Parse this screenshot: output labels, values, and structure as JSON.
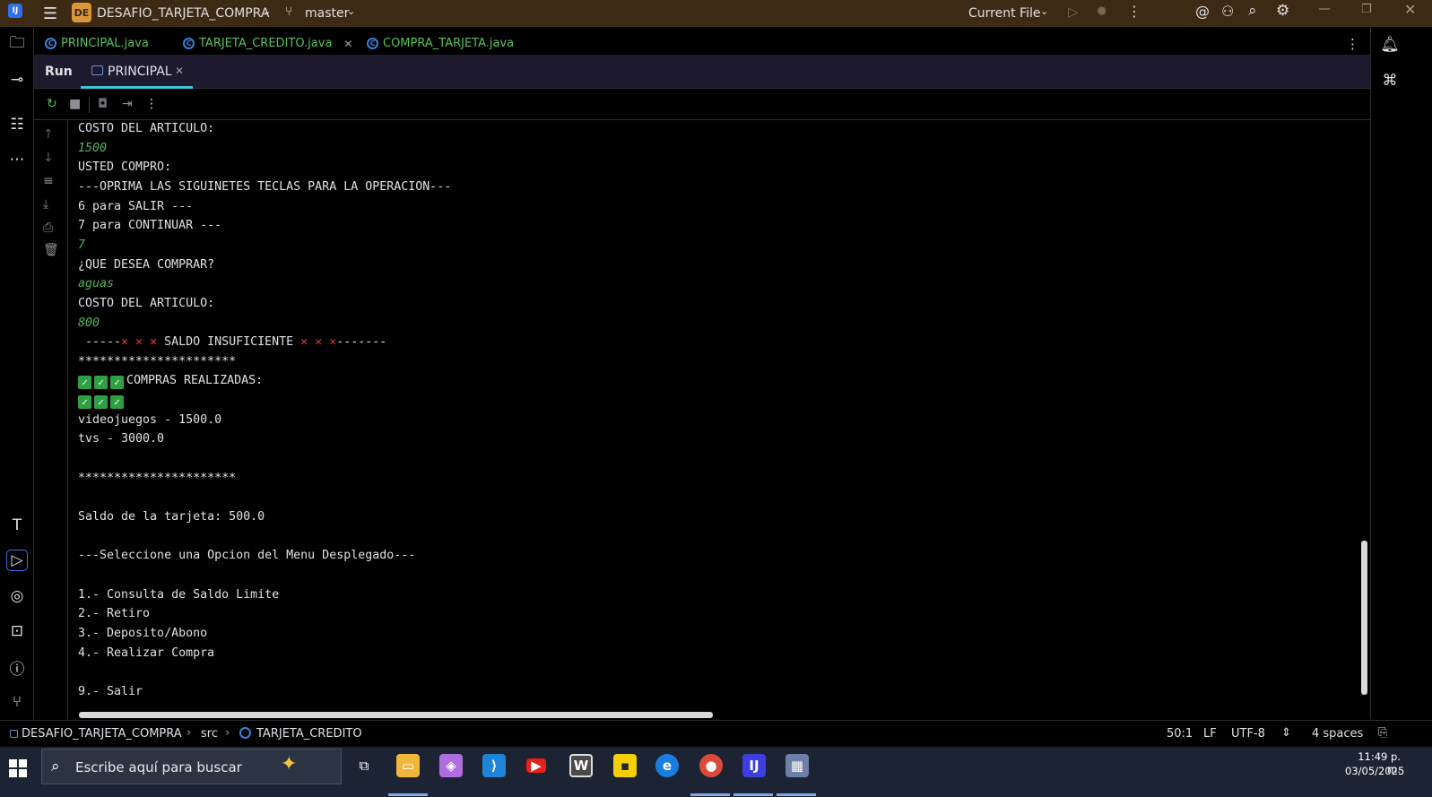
{
  "titlebar": {
    "app_logo": "IJ",
    "project_badge": "DE",
    "project_name": "DESAFIO_TARJETA_COMPRA",
    "branch_name": "master",
    "run_config": "Current File"
  },
  "editor_tabs": [
    {
      "label": "PRINCIPAL.java",
      "closable": false
    },
    {
      "label": "TARJETA_CREDITO.java",
      "closable": true
    },
    {
      "label": "COMPRA_TARJETA.java",
      "closable": false
    }
  ],
  "run_window": {
    "label": "Run",
    "tab_label": "PRINCIPAL"
  },
  "console": {
    "lines": [
      {
        "text": "COSTO DEL ARTICULO:",
        "kind": "output"
      },
      {
        "text": "1500",
        "kind": "input"
      },
      {
        "text": "USTED COMPRO:",
        "kind": "output"
      },
      {
        "text": "---OPRIMA LAS SIGUINETES TECLAS PARA LA OPERACION---",
        "kind": "output"
      },
      {
        "text": "6 para SALIR ---",
        "kind": "output"
      },
      {
        "text": "7 para CONTINUAR ---",
        "kind": "output"
      },
      {
        "text": "7",
        "kind": "input"
      },
      {
        "text": "¿QUE DESEA COMPRAR?",
        "kind": "output"
      },
      {
        "text": "aguas",
        "kind": "input"
      },
      {
        "text": "COSTO DEL ARTICULO:",
        "kind": "output"
      },
      {
        "text": "800",
        "kind": "input"
      },
      {
        "text": " -----",
        "after": " SALDO INSUFICIENTE ",
        "tail": "-------",
        "kind": "saldo"
      },
      {
        "text": "**********************",
        "kind": "output"
      },
      {
        "text": "COMPRAS REALIZADAS:",
        "kind": "checks"
      },
      {
        "text": "",
        "kind": "checks-only"
      },
      {
        "text": "videojuegos - 1500.0",
        "kind": "output"
      },
      {
        "text": "tvs - 3000.0",
        "kind": "output"
      },
      {
        "text": "",
        "kind": "blank"
      },
      {
        "text": "**********************",
        "kind": "output"
      },
      {
        "text": "",
        "kind": "blank"
      },
      {
        "text": "Saldo de la tarjeta: 500.0",
        "kind": "output"
      },
      {
        "text": "",
        "kind": "blank"
      },
      {
        "text": "---Seleccione una Opcion del Menu Desplegado---",
        "kind": "output"
      },
      {
        "text": "",
        "kind": "blank"
      },
      {
        "text": "1.- Consulta de Saldo Limite",
        "kind": "output"
      },
      {
        "text": "2.- Retiro",
        "kind": "output"
      },
      {
        "text": "3.- Deposito/Abono",
        "kind": "output"
      },
      {
        "text": "4.- Realizar Compra",
        "kind": "output"
      },
      {
        "text": "",
        "kind": "blank"
      },
      {
        "text": "9.- Salir",
        "kind": "output"
      }
    ]
  },
  "statusbar": {
    "module": "DESAFIO_TARJETA_COMPRA",
    "folder": "src",
    "class_name": "TARJETA_CREDITO",
    "position": "50:1",
    "line_sep": "LF",
    "encoding": "UTF-8",
    "indent": "4 spaces"
  },
  "taskbar": {
    "search_placeholder": "Escribe aquí para buscar",
    "time": "11:49 p. m.",
    "date": "03/05/2025"
  },
  "colors": {
    "titlebar_bg": "#3d2a14",
    "run_header_bg": "#1e1a2e",
    "tab_underline": "#3cc4d8",
    "input_text": "#57b55b",
    "error_mark": "#e03a3a",
    "check_mark": "#2ea043",
    "taskbar_bg": "#1c2434"
  }
}
